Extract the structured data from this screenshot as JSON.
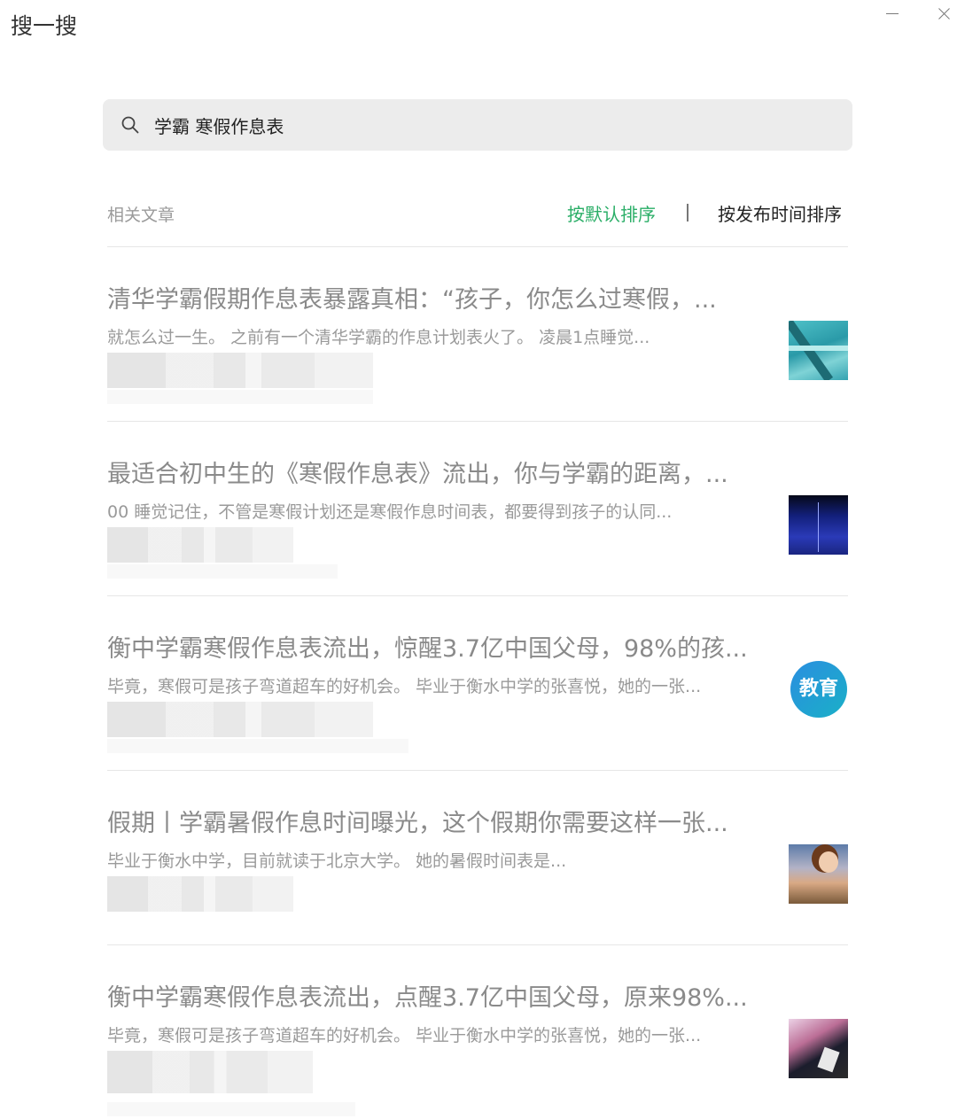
{
  "window": {
    "title": "搜一搜",
    "minimize_label": "",
    "close_label": ""
  },
  "search": {
    "query": "学霸 寒假作息表",
    "icon": "search-icon"
  },
  "section": {
    "label": "相关文章",
    "sort_default": "按默认排序",
    "sort_time": "按发布时间排序",
    "active_color": "#2aae67"
  },
  "results": [
    {
      "title": "清华学霸假期作息表暴露真相：“孩子，你怎么过寒假，...",
      "snippet": "就怎么过一生。 之前有一个清华学霸的作息计划表火了。 凌晨1点睡觉...",
      "thumbnail": "swimming-pool-image"
    },
    {
      "title": "最适合初中生的《寒假作息表》流出，你与学霸的距离，...",
      "snippet": "00 睡觉记住，不管是寒假计划还是寒假作息时间表，都要得到孩子的认同...",
      "thumbnail": "book-night-image"
    },
    {
      "title": "衡中学霸寒假作息表流出，惊醒3.7亿中国父母，98%的孩...",
      "snippet": "毕竟，寒假可是孩子弯道超车的好机会。 毕业于衡水中学的张喜悦，她的一张...",
      "thumbnail": "education-badge",
      "badge_text": "教育"
    },
    {
      "title": "假期丨学霸暑假作息时间曝光，这个假期你需要这样一张...",
      "snippet": "毕业于衡水中学，目前就读于北京大学。 她的暑假时间表是...",
      "thumbnail": "student-girl-image"
    },
    {
      "title": "衡中学霸寒假作息表流出，点醒3.7亿中国父母，原来98%...",
      "snippet": "毕竟，寒假可是孩子弯道超车的好机会。 毕业于衡水中学的张喜悦，她的一张...",
      "thumbnail": "graduation-image"
    }
  ]
}
